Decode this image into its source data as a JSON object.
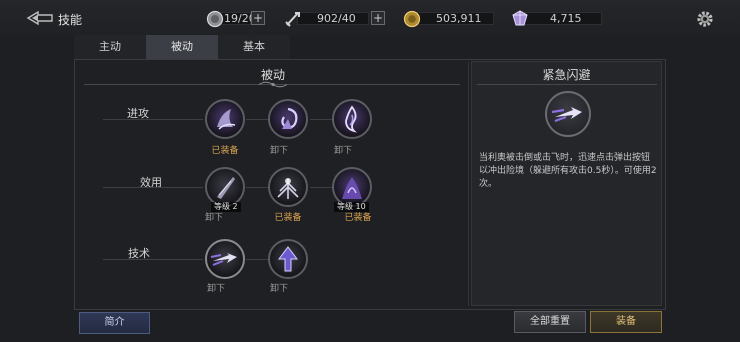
{
  "header": {
    "title": "技能",
    "resources": [
      {
        "name": "stamina",
        "value": "19/20",
        "icon": "silver-coin-icon"
      },
      {
        "name": "energy",
        "value": "902/40",
        "icon": "sword-icon"
      },
      {
        "name": "gold",
        "value": "503,911",
        "icon": "gold-coin-icon"
      },
      {
        "name": "crystal",
        "value": "4,715",
        "icon": "crystal-icon"
      }
    ],
    "plus": "+"
  },
  "tabs": [
    {
      "label": "主动",
      "active": false
    },
    {
      "label": "被动",
      "active": true
    },
    {
      "label": "基本",
      "active": false
    }
  ],
  "skills_panel": {
    "heading": "被动",
    "rows": [
      {
        "label": "进攻",
        "skills": [
          {
            "icon": "claw-slash-icon",
            "status": "已装备",
            "equipped": true
          },
          {
            "icon": "spiral-strike-icon",
            "status": "卸下",
            "equipped": false
          },
          {
            "icon": "spirit-flame-icon",
            "status": "卸下",
            "equipped": false
          }
        ]
      },
      {
        "label": "效用",
        "skills": [
          {
            "icon": "blade-edge-icon",
            "level": "等级 2",
            "status": "卸下",
            "equipped": false
          },
          {
            "icon": "burst-icon",
            "status": "已装备",
            "equipped": true
          },
          {
            "icon": "shadow-rise-icon",
            "level": "等级 10",
            "status": "已装备",
            "equipped": true
          }
        ]
      },
      {
        "label": "技术",
        "skills": [
          {
            "icon": "dash-arrow-icon",
            "status": "卸下",
            "equipped": false,
            "selected": true
          },
          {
            "icon": "up-arrow-icon",
            "status": "卸下",
            "equipped": false
          }
        ]
      }
    ]
  },
  "detail": {
    "title": "紧急闪避",
    "icon": "dash-arrow-icon",
    "description": "当利奥被击倒或击飞时，迅速点击弹出按钮以冲出险境（躲避所有攻击0.5秒）。可使用2次。"
  },
  "buttons": {
    "intro": "简介",
    "reset_all": "全部重置",
    "equip": "装备"
  },
  "colors": {
    "equipped": "#d8a24e",
    "unequipped": "#9c9c9c",
    "accent_purple": "#7b5cc4"
  }
}
